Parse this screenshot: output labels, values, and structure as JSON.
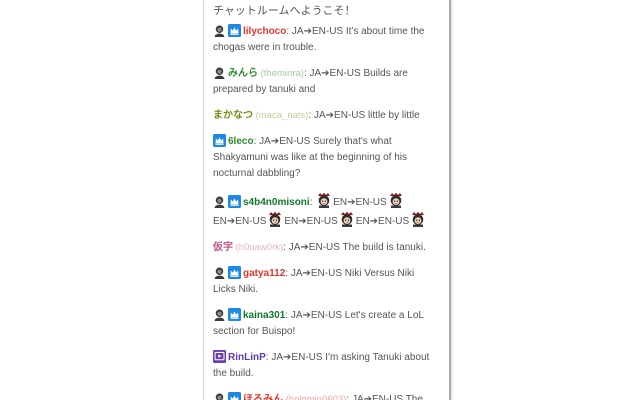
{
  "welcome": "チャットルームへようこそ！",
  "colors": {
    "text": "#555555",
    "panel_border": "#a8a8a8",
    "badge_blue": "#1e88e5",
    "badge_purple": "#6a3db3"
  },
  "messages": [
    {
      "badges": [
        "avatar",
        "crown"
      ],
      "name": "lilychoco",
      "name_color": "#e8352c",
      "login": "",
      "segments": [
        {
          "t": "text",
          "v": "JA➔EN-US It's about time the chogas were in trouble."
        }
      ]
    },
    {
      "badges": [
        "avatar"
      ],
      "name": "みんら",
      "name_color": "#2e8b2e",
      "login": "(theminra)",
      "segments": [
        {
          "t": "text",
          "v": "JA➔EN-US Builds are prepared by tanuki and"
        }
      ]
    },
    {
      "badges": [],
      "name": "まかなつ",
      "name_color": "#7a8a16",
      "login": "(maca_nats)",
      "segments": [
        {
          "t": "text",
          "v": "JA➔EN-US little by little"
        }
      ]
    },
    {
      "badges": [
        "crown"
      ],
      "name": "6leco",
      "name_color": "#2e8b2e",
      "login": "",
      "segments": [
        {
          "t": "text",
          "v": "JA➔EN-US Surely that's what Shakyamuni was like at the beginning of his nocturnal dabbling?"
        }
      ]
    },
    {
      "badges": [
        "avatar",
        "crown"
      ],
      "name": "s4b4n0misoni",
      "name_color": "#0f7a2a",
      "login": "",
      "segments": [
        {
          "t": "emote"
        },
        {
          "t": "text",
          "v": "EN➔EN-US"
        },
        {
          "t": "emote"
        },
        {
          "t": "text",
          "v": "EN➔EN-US"
        },
        {
          "t": "emote"
        },
        {
          "t": "text",
          "v": "EN➔EN-US"
        },
        {
          "t": "emote"
        },
        {
          "t": "text",
          "v": "EN➔EN-US"
        },
        {
          "t": "emote"
        }
      ]
    },
    {
      "badges": [],
      "name": "仮字",
      "name_color": "#c0558a",
      "login": "(h0uaw0rk)",
      "segments": [
        {
          "t": "text",
          "v": "JA➔EN-US The build is tanuki."
        }
      ]
    },
    {
      "badges": [
        "avatar",
        "crown"
      ],
      "name": "gatya112",
      "name_color": "#e8352c",
      "login": "",
      "segments": [
        {
          "t": "text",
          "v": "JA➔EN-US Niki Versus Niki Licks Niki."
        }
      ]
    },
    {
      "badges": [
        "avatar",
        "crown"
      ],
      "name": "kaina301",
      "name_color": "#0f7a2a",
      "login": "",
      "segments": [
        {
          "t": "text",
          "v": "JA➔EN-US Let's create a LoL section for Buispo!"
        }
      ]
    },
    {
      "badges": [
        "play"
      ],
      "name": "RinLinP",
      "name_color": "#5b3bb0",
      "login": "",
      "segments": [
        {
          "t": "text",
          "v": "JA➔EN-US I'm asking Tanuki about the build."
        }
      ]
    },
    {
      "badges": [
        "avatar",
        "crown"
      ],
      "name": "ほろみん",
      "name_color": "#e8352c",
      "login": "(holomin0603)",
      "segments": [
        {
          "t": "text",
          "v": "JA➔EN-US The"
        }
      ]
    }
  ]
}
